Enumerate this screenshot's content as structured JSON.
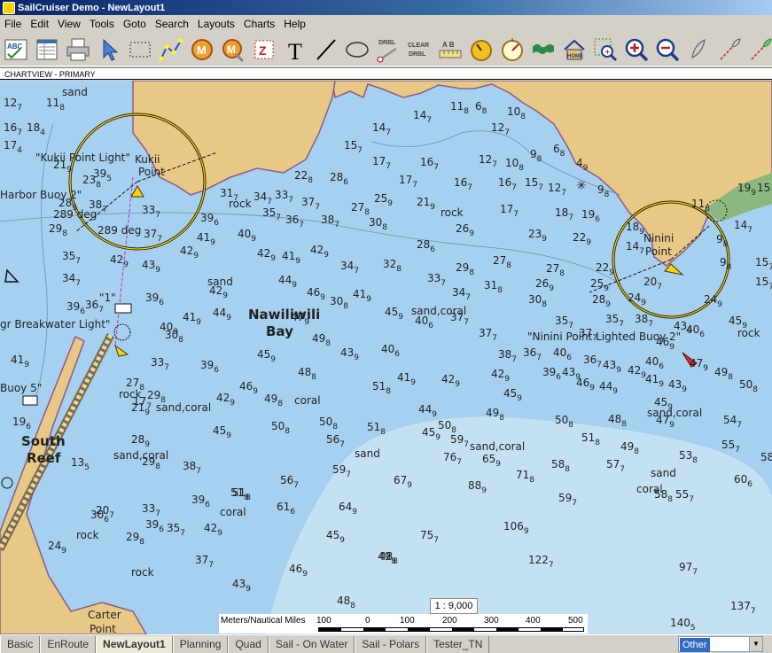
{
  "window": {
    "title": "SailCruiser Demo - NewLayout1"
  },
  "menu": [
    "File",
    "Edit",
    "View",
    "Tools",
    "Goto",
    "Search",
    "Layouts",
    "Charts",
    "Help"
  ],
  "toolbar": {
    "tools": [
      "abc-icon",
      "chart-table-icon",
      "printer-icon",
      "cursor-icon",
      "select-rect-icon",
      "route-icon",
      "mark-m-icon",
      "mark-m-shadow-icon",
      "mark-z-icon",
      "text-tool-icon",
      "line-tool-icon",
      "ellipse-tool-icon",
      "drbl-icon",
      "clear-drbl-icon",
      "ruler-ab-icon",
      "speed-icon",
      "compass-icon",
      "world-map-icon",
      "home-icon",
      "zoom-area-icon",
      "zoom-in-icon",
      "zoom-out-icon",
      "boat-icon",
      "track-icon",
      "track-green-icon"
    ],
    "drbl_label": "DRBL",
    "clear_label": "CLEAR",
    "clear_label2": "DRBL",
    "text_glyph": "T",
    "ab_label": "A B",
    "home_label": "HOME"
  },
  "chart_view": {
    "label": "CHARTVIEW - PRIMARY"
  },
  "map": {
    "place_names": [
      "Nawiliwili",
      "Bay",
      "South",
      "Reef"
    ],
    "features": [
      "\"Kukii Point Light\"",
      "Kukii",
      "Point",
      "Harbor Buoy 2\"",
      "289 deg",
      "289 deg",
      "\"1\"",
      "gr Breakwater Light\"",
      "Buoy 5\"",
      "\"Ninini Point Lighted Buoy 2\"",
      "Ninini",
      "Point",
      "Carter",
      "Point"
    ],
    "seabed": [
      "sand",
      "rock",
      "sand,coral",
      "coral",
      "sand",
      "rock",
      "sand,coral",
      "rock",
      "sand,coral",
      "coral",
      "sand",
      "rock",
      "sand,coral",
      "sand,coral",
      "rock",
      "sand",
      "coral",
      "rock"
    ],
    "soundings": [
      "12 7",
      "11 8",
      "16 7",
      "17 4",
      "18 4",
      "21 9",
      "23 8",
      "28 9",
      "29 8",
      "35 7",
      "37 2",
      "39 9",
      "36 7",
      "41 9",
      "33 7",
      "30 8",
      "31 8",
      "23 9",
      "21 3",
      "20 7",
      "15 7",
      "13 5",
      "14 7",
      "11 8",
      "6 8",
      "10 8",
      "12 7",
      "12 6",
      "9 8",
      "6 8",
      "4 9",
      "14 7",
      "15 7",
      "17 7",
      "16 7",
      "12 7",
      "16 7",
      "9 8",
      "12 7",
      "22 8",
      "28 6",
      "25 9",
      "21 9",
      "26 9",
      "27 8",
      "31 8",
      "33 7",
      "34 7",
      "39 6",
      "36 7",
      "37 7",
      "38 7",
      "42 9",
      "42 9",
      "44 9",
      "42 9",
      "46 9",
      "44 9",
      "45 9",
      "49 8",
      "47 9",
      "51 8",
      "50 8",
      "45 9",
      "41 8",
      "43 9",
      "48 8",
      "44 9",
      "49 9",
      "42 9",
      "45 9",
      "46 9",
      "49 8",
      "50 8",
      "51 8",
      "56 7",
      "59 7",
      "61 6",
      "64 9",
      "67 9",
      "65 9",
      "76 7",
      "88 9",
      "75 7",
      "71 8",
      "106 9",
      "122 7",
      "97 7",
      "137 7",
      "140 5",
      "48 8",
      "46 9",
      "45 9",
      "43 9",
      "39 6",
      "38 7",
      "37 7",
      "36 7",
      "35 7",
      "33 7",
      "30 8",
      "29 8",
      "28 9",
      "26 9",
      "23 9",
      "22 9",
      "17 7",
      "18 7",
      "19 6"
    ],
    "sounding_points": [
      [
        "12",
        7,
        4,
        120
      ],
      [
        "11",
        8,
        52,
        120
      ],
      [
        "16",
        7,
        4,
        148
      ],
      [
        "17",
        4,
        4,
        168
      ],
      [
        "18",
        4,
        30,
        148
      ],
      [
        "21",
        9,
        60,
        190
      ],
      [
        "23",
        8,
        93,
        207
      ],
      [
        "28",
        9,
        66,
        233
      ],
      [
        "29",
        8,
        55,
        262
      ],
      [
        "35",
        7,
        70,
        293
      ],
      [
        "34",
        7,
        70,
        318
      ],
      [
        "39",
        6,
        75,
        350
      ],
      [
        "36",
        7,
        96,
        348
      ],
      [
        "41",
        9,
        12,
        410
      ],
      [
        "39",
        5,
        105,
        200
      ],
      [
        "38",
        7,
        100,
        235
      ],
      [
        "33",
        7,
        160,
        241
      ],
      [
        "37",
        7,
        162,
        268
      ],
      [
        "39",
        6,
        226,
        250
      ],
      [
        "41",
        9,
        222,
        272
      ],
      [
        "42",
        9,
        203,
        287
      ],
      [
        "43",
        9,
        160,
        303
      ],
      [
        "42",
        9,
        124,
        297
      ],
      [
        "39",
        6,
        164,
        340
      ],
      [
        "41",
        9,
        206,
        362
      ],
      [
        "44",
        9,
        240,
        357
      ],
      [
        "42",
        9,
        236,
        332
      ],
      [
        "40",
        9,
        180,
        373
      ],
      [
        "39",
        6,
        226,
        416
      ],
      [
        "42",
        9,
        244,
        453
      ],
      [
        "45",
        9,
        240,
        490
      ],
      [
        "39",
        6,
        216,
        568
      ],
      [
        "42",
        9,
        230,
        600
      ],
      [
        "37",
        7,
        220,
        636
      ],
      [
        "43",
        9,
        262,
        663
      ],
      [
        "38",
        7,
        206,
        530
      ],
      [
        "51",
        8,
        260,
        560
      ],
      [
        "39",
        6,
        164,
        596
      ],
      [
        "35",
        7,
        188,
        600
      ],
      [
        "33",
        7,
        160,
        578
      ],
      [
        "28",
        9,
        148,
        500
      ],
      [
        "29",
        8,
        160,
        525
      ],
      [
        "30",
        6,
        102,
        585
      ],
      [
        "29",
        8,
        142,
        610
      ],
      [
        "24",
        9,
        54,
        620
      ],
      [
        "19",
        6,
        14,
        480
      ],
      [
        "13",
        5,
        80,
        526
      ],
      [
        "20",
        7,
        108,
        580
      ],
      [
        "17",
        7,
        150,
        457
      ],
      [
        "21",
        9,
        148,
        464
      ],
      [
        "29",
        8,
        166,
        450
      ],
      [
        "33",
        7,
        170,
        413
      ],
      [
        "30",
        8,
        186,
        382
      ],
      [
        "27",
        8,
        142,
        436
      ],
      [
        "31",
        7,
        248,
        222
      ],
      [
        "34",
        7,
        286,
        226
      ],
      [
        "33",
        7,
        310,
        224
      ],
      [
        "35",
        7,
        296,
        244
      ],
      [
        "36",
        7,
        322,
        252
      ],
      [
        "37",
        7,
        340,
        232
      ],
      [
        "38",
        7,
        362,
        252
      ],
      [
        "22",
        8,
        332,
        202
      ],
      [
        "28",
        6,
        372,
        204
      ],
      [
        "27",
        8,
        396,
        238
      ],
      [
        "30",
        8,
        416,
        255
      ],
      [
        "25",
        9,
        422,
        228
      ],
      [
        "21",
        9,
        470,
        232
      ],
      [
        "17",
        7,
        450,
        207
      ],
      [
        "16",
        7,
        474,
        187
      ],
      [
        "15",
        7,
        388,
        168
      ],
      [
        "17",
        7,
        420,
        186
      ],
      [
        "14",
        7,
        420,
        148
      ],
      [
        "14",
        7,
        466,
        134
      ],
      [
        "11",
        8,
        508,
        124
      ],
      [
        "6",
        8,
        536,
        124
      ],
      [
        "10",
        8,
        572,
        130
      ],
      [
        "12",
        7,
        554,
        148
      ],
      [
        "12",
        7,
        540,
        184
      ],
      [
        "10",
        8,
        570,
        188
      ],
      [
        "9",
        8,
        598,
        178
      ],
      [
        "6",
        8,
        624,
        172
      ],
      [
        "16",
        7,
        562,
        210
      ],
      [
        "16",
        7,
        512,
        210
      ],
      [
        "17",
        7,
        564,
        240
      ],
      [
        "18",
        7,
        626,
        244
      ],
      [
        "19",
        6,
        656,
        246
      ],
      [
        "22",
        9,
        646,
        272
      ],
      [
        "23",
        9,
        596,
        268
      ],
      [
        "4",
        9,
        650,
        188
      ],
      [
        "12",
        7,
        618,
        216
      ],
      [
        "15",
        7,
        592,
        210
      ],
      [
        "9",
        8,
        674,
        218
      ],
      [
        "42",
        9,
        350,
        286
      ],
      [
        "34",
        7,
        384,
        304
      ],
      [
        "32",
        8,
        432,
        302
      ],
      [
        "33",
        7,
        482,
        318
      ],
      [
        "34",
        7,
        510,
        334
      ],
      [
        "29",
        8,
        514,
        306
      ],
      [
        "27",
        8,
        556,
        298
      ],
      [
        "31",
        8,
        546,
        326
      ],
      [
        "28",
        6,
        470,
        280
      ],
      [
        "26",
        9,
        514,
        262
      ],
      [
        "27",
        8,
        616,
        307
      ],
      [
        "26",
        9,
        604,
        324
      ],
      [
        "30",
        8,
        596,
        342
      ],
      [
        "30",
        8,
        372,
        344
      ],
      [
        "41",
        9,
        398,
        336
      ],
      [
        "45",
        9,
        434,
        356
      ],
      [
        "40",
        6,
        468,
        366
      ],
      [
        "37",
        7,
        508,
        362
      ],
      [
        "37",
        7,
        540,
        380
      ],
      [
        "46",
        9,
        346,
        334
      ],
      [
        "44",
        9,
        314,
        320
      ],
      [
        "41",
        9,
        318,
        293
      ],
      [
        "42",
        9,
        290,
        290
      ],
      [
        "40",
        9,
        268,
        268
      ],
      [
        "47",
        9,
        328,
        362
      ],
      [
        "49",
        8,
        352,
        386
      ],
      [
        "45",
        9,
        290,
        404
      ],
      [
        "43",
        9,
        384,
        402
      ],
      [
        "40",
        6,
        430,
        398
      ],
      [
        "46",
        9,
        270,
        440
      ],
      [
        "49",
        8,
        298,
        454
      ],
      [
        "48",
        8,
        336,
        424
      ],
      [
        "51",
        8,
        420,
        440
      ],
      [
        "41",
        9,
        448,
        430
      ],
      [
        "42",
        9,
        498,
        432
      ],
      [
        "44",
        9,
        472,
        466
      ],
      [
        "38",
        7,
        562,
        404
      ],
      [
        "36",
        7,
        590,
        402
      ],
      [
        "39",
        6,
        612,
        424
      ],
      [
        "42",
        9,
        554,
        426
      ],
      [
        "45",
        9,
        568,
        448
      ],
      [
        "49",
        8,
        548,
        470
      ],
      [
        "50",
        8,
        494,
        484
      ],
      [
        "45",
        9,
        476,
        492
      ],
      [
        "59",
        7,
        508,
        500
      ],
      [
        "51",
        8,
        414,
        486
      ],
      [
        "50",
        8,
        306,
        485
      ],
      [
        "50",
        8,
        360,
        480
      ],
      [
        "56",
        7,
        368,
        500
      ],
      [
        "59",
        7,
        375,
        534
      ],
      [
        "56",
        7,
        316,
        546
      ],
      [
        "61",
        6,
        312,
        576
      ],
      [
        "64",
        9,
        382,
        576
      ],
      [
        "67",
        9,
        444,
        546
      ],
      [
        "76",
        7,
        500,
        520
      ],
      [
        "65",
        9,
        544,
        522
      ],
      [
        "71",
        8,
        582,
        540
      ],
      [
        "88",
        9,
        528,
        552
      ],
      [
        "75",
        7,
        474,
        608
      ],
      [
        "49",
        8,
        426,
        632
      ],
      [
        "45",
        9,
        368,
        608
      ],
      [
        "46",
        9,
        326,
        646
      ],
      [
        "48",
        8,
        380,
        682
      ],
      [
        "51",
        8,
        262,
        560
      ],
      [
        "40",
        6,
        624,
        402
      ],
      [
        "43",
        9,
        634,
        424
      ],
      [
        "46",
        9,
        650,
        436
      ],
      [
        "48",
        8,
        686,
        477
      ],
      [
        "44",
        9,
        676,
        440
      ],
      [
        "43",
        9,
        680,
        416
      ],
      [
        "36",
        7,
        658,
        410
      ],
      [
        "35",
        7,
        683,
        364
      ],
      [
        "35",
        7,
        626,
        366
      ],
      [
        "37",
        7,
        653,
        380
      ],
      [
        "40",
        6,
        728,
        412
      ],
      [
        "42",
        9,
        708,
        422
      ],
      [
        "41",
        9,
        728,
        432
      ],
      [
        "49",
        8,
        700,
        508
      ],
      [
        "47",
        9,
        740,
        478
      ],
      [
        "45",
        9,
        738,
        458
      ],
      [
        "43",
        9,
        754,
        438
      ],
      [
        "46",
        9,
        740,
        390
      ],
      [
        "43",
        9,
        760,
        372
      ],
      [
        "38",
        7,
        716,
        364
      ],
      [
        "40",
        6,
        774,
        376
      ],
      [
        "45",
        9,
        822,
        366
      ],
      [
        "47",
        9,
        778,
        414
      ],
      [
        "49",
        8,
        806,
        424
      ],
      [
        "50",
        8,
        834,
        438
      ],
      [
        "53",
        8,
        766,
        518
      ],
      [
        "54",
        7,
        816,
        478
      ],
      [
        "55",
        7,
        814,
        506
      ],
      [
        "57",
        7,
        684,
        528
      ],
      [
        "55",
        7,
        762,
        562
      ],
      [
        "58",
        8,
        738,
        562
      ],
      [
        "60",
        6,
        828,
        545
      ],
      [
        "59",
        7,
        630,
        566
      ],
      [
        "51",
        8,
        656,
        498
      ],
      [
        "50",
        8,
        626,
        478
      ],
      [
        "58",
        8,
        622,
        528
      ],
      [
        "58",
        7,
        858,
        520
      ],
      [
        "19",
        9,
        832,
        216
      ],
      [
        "14",
        7,
        828,
        258
      ],
      [
        "9",
        8,
        808,
        274
      ],
      [
        "9",
        8,
        812,
        300
      ],
      [
        "24",
        9,
        794,
        342
      ],
      [
        "11",
        8,
        780,
        234
      ],
      [
        "14",
        7,
        706,
        282
      ],
      [
        "18",
        9,
        706,
        260
      ],
      [
        "22",
        9,
        672,
        306
      ],
      [
        "25",
        9,
        666,
        324
      ],
      [
        "24",
        9,
        708,
        340
      ],
      [
        "28",
        9,
        668,
        342
      ],
      [
        "20",
        7,
        726,
        322
      ],
      [
        "15",
        7,
        854,
        216
      ],
      [
        "15",
        7,
        852,
        300
      ],
      [
        "15",
        7,
        852,
        322
      ],
      [
        "106",
        9,
        568,
        598
      ],
      [
        "122",
        7,
        596,
        636
      ],
      [
        "97",
        7,
        766,
        644
      ],
      [
        "137",
        7,
        824,
        688
      ],
      [
        "140",
        5,
        756,
        707
      ],
      [
        "48",
        8,
        428,
        632
      ]
    ]
  },
  "scale": {
    "ratio": "1 : 9,000",
    "unit": "Meters/Nautical Miles",
    "ticks": [
      "100",
      "0",
      "100",
      "200",
      "300",
      "400",
      "500"
    ]
  },
  "tabs": [
    {
      "label": "Basic",
      "active": false
    },
    {
      "label": "EnRoute",
      "active": false
    },
    {
      "label": "NewLayout1",
      "active": true
    },
    {
      "label": "Planning",
      "active": false
    },
    {
      "label": "Quad",
      "active": false
    },
    {
      "label": "Sail - On Water",
      "active": false
    },
    {
      "label": "Sail - Polars",
      "active": false
    },
    {
      "label": "Tester_TN",
      "active": false
    }
  ],
  "layout_selector": {
    "value": "Other"
  },
  "colors": {
    "deep_water": "#a6d0ef",
    "shallow_water": "#c4e1f4",
    "land": "#e8c885",
    "vegetation": "#8cb880",
    "title_start": "#0a246a",
    "coast_line": "#8b5a8b"
  }
}
